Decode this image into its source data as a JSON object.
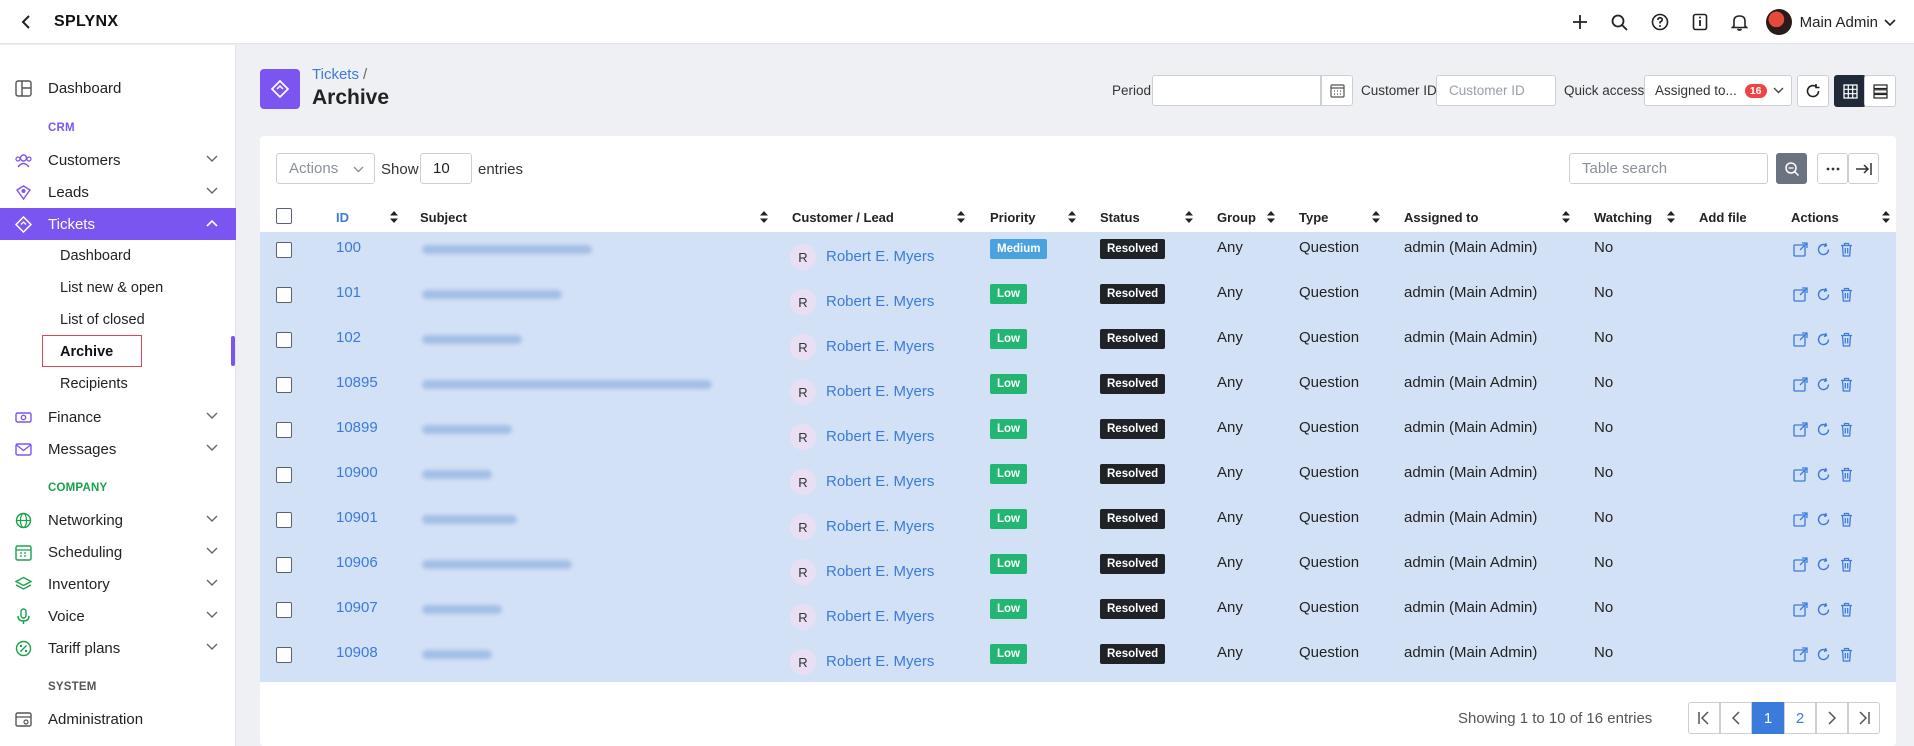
{
  "app": {
    "brand": "SPLYNX"
  },
  "header": {
    "user_name": "Main Admin"
  },
  "sidebar": {
    "dashboard": "Dashboard",
    "section_crm": "CRM",
    "customers": "Customers",
    "leads": "Leads",
    "tickets": "Tickets",
    "tickets_sub": [
      "Dashboard",
      "List new & open",
      "List of closed",
      "Archive",
      "Recipients"
    ],
    "finance": "Finance",
    "messages": "Messages",
    "section_company": "COMPANY",
    "networking": "Networking",
    "scheduling": "Scheduling",
    "inventory": "Inventory",
    "voice": "Voice",
    "tariff_plans": "Tariff plans",
    "section_system": "SYSTEM",
    "administration": "Administration"
  },
  "page": {
    "breadcrumb": "Tickets",
    "breadcrumb_sep": "/",
    "title": "Archive"
  },
  "filters": {
    "period_label": "Period",
    "customer_id_label": "Customer ID",
    "customer_id_placeholder": "Customer ID",
    "quick_access_label": "Quick access",
    "quick_access_value": "Assigned to...",
    "quick_access_badge": "16"
  },
  "toolbar": {
    "actions_label": "Actions",
    "show_label": "Show",
    "show_value": "10",
    "entries_label": "entries",
    "search_placeholder": "Table search"
  },
  "table": {
    "columns": [
      "ID",
      "Subject",
      "Customer / Lead",
      "Priority",
      "Status",
      "Group",
      "Type",
      "Assigned to",
      "Watching",
      "Add file",
      "Actions"
    ],
    "rows": [
      {
        "id": "100",
        "customer": "Robert E. Myers",
        "avatar": "R",
        "priority": "Medium",
        "status": "Resolved",
        "group": "Any",
        "type": "Question",
        "assigned": "admin (Main Admin)",
        "watching": "No"
      },
      {
        "id": "101",
        "customer": "Robert E. Myers",
        "avatar": "R",
        "priority": "Low",
        "status": "Resolved",
        "group": "Any",
        "type": "Question",
        "assigned": "admin (Main Admin)",
        "watching": "No"
      },
      {
        "id": "102",
        "customer": "Robert E. Myers",
        "avatar": "R",
        "priority": "Low",
        "status": "Resolved",
        "group": "Any",
        "type": "Question",
        "assigned": "admin (Main Admin)",
        "watching": "No"
      },
      {
        "id": "10895",
        "customer": "Robert E. Myers",
        "avatar": "R",
        "priority": "Low",
        "status": "Resolved",
        "group": "Any",
        "type": "Question",
        "assigned": "admin (Main Admin)",
        "watching": "No"
      },
      {
        "id": "10899",
        "customer": "Robert E. Myers",
        "avatar": "R",
        "priority": "Low",
        "status": "Resolved",
        "group": "Any",
        "type": "Question",
        "assigned": "admin (Main Admin)",
        "watching": "No"
      },
      {
        "id": "10900",
        "customer": "Robert E. Myers",
        "avatar": "R",
        "priority": "Low",
        "status": "Resolved",
        "group": "Any",
        "type": "Question",
        "assigned": "admin (Main Admin)",
        "watching": "No"
      },
      {
        "id": "10901",
        "customer": "Robert E. Myers",
        "avatar": "R",
        "priority": "Low",
        "status": "Resolved",
        "group": "Any",
        "type": "Question",
        "assigned": "admin (Main Admin)",
        "watching": "No"
      },
      {
        "id": "10906",
        "customer": "Robert E. Myers",
        "avatar": "R",
        "priority": "Low",
        "status": "Resolved",
        "group": "Any",
        "type": "Question",
        "assigned": "admin (Main Admin)",
        "watching": "No"
      },
      {
        "id": "10907",
        "customer": "Robert E. Myers",
        "avatar": "R",
        "priority": "Low",
        "status": "Resolved",
        "group": "Any",
        "type": "Question",
        "assigned": "admin (Main Admin)",
        "watching": "No"
      },
      {
        "id": "10908",
        "customer": "Robert E. Myers",
        "avatar": "R",
        "priority": "Low",
        "status": "Resolved",
        "group": "Any",
        "type": "Question",
        "assigned": "admin (Main Admin)",
        "watching": "No"
      }
    ]
  },
  "pagination": {
    "summary": "Showing 1 to 10 of 16 entries",
    "pages": [
      "1",
      "2"
    ],
    "current": "1"
  },
  "colors": {
    "accent": "#7a55f0",
    "link": "#3b7bdc",
    "selected_row": "#d3e1f6",
    "priority_low": "#22b573",
    "priority_medium": "#4aa3df",
    "status_resolved": "#1f2328",
    "badge": "#ef4444"
  }
}
